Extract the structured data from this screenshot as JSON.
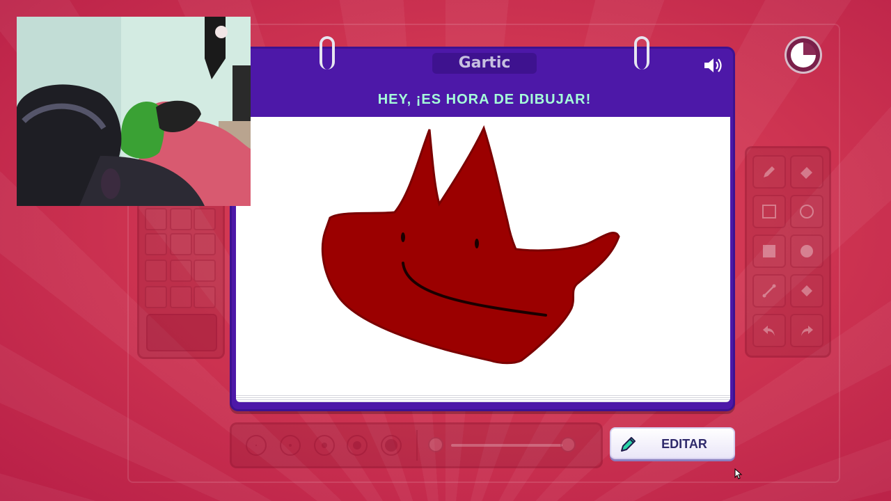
{
  "app": {
    "logo_text": "Gartic",
    "header_title": "HEY, ¡ES HORA DE DIBUJAR!"
  },
  "timer": {
    "icon": "timer-pie-icon",
    "elapsed_fraction": 0.25
  },
  "sound": {
    "icon": "speaker-icon"
  },
  "edit_button": {
    "label": "EDITAR",
    "icon": "pencil-icon"
  },
  "tools": [
    {
      "name": "pencil-icon"
    },
    {
      "name": "eraser-icon"
    },
    {
      "name": "square-outline-icon"
    },
    {
      "name": "circle-outline-icon"
    },
    {
      "name": "square-filled-icon"
    },
    {
      "name": "circle-filled-icon"
    },
    {
      "name": "line-icon"
    },
    {
      "name": "fill-bucket-icon"
    },
    {
      "name": "undo-icon"
    },
    {
      "name": "redo-icon"
    }
  ],
  "brush_sizes": [
    1,
    2,
    3,
    4,
    5
  ],
  "opacity_slider": {
    "value": 1.0
  },
  "colors": {
    "background": "#cf3552",
    "card": "#4d18a8",
    "header_text": "#a6ffda",
    "drawing_fill": "#9b0000",
    "drawing_stroke": "#7a0000"
  }
}
